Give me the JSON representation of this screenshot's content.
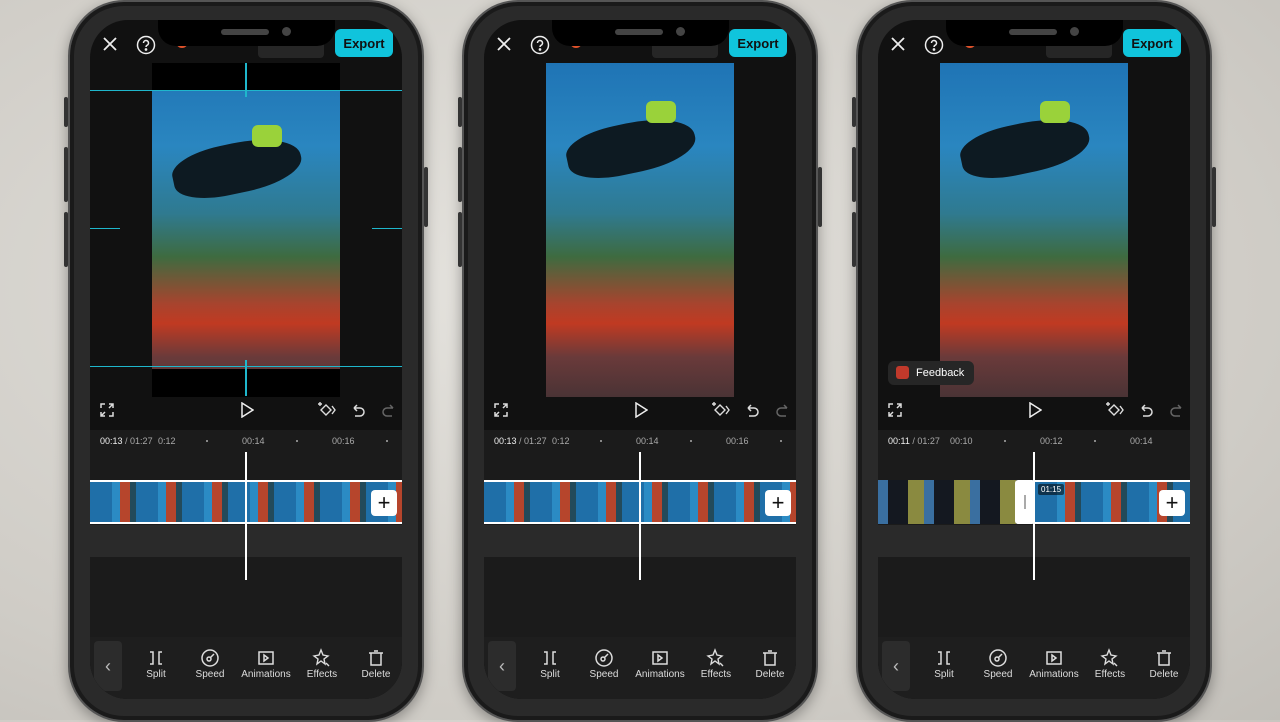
{
  "accent_color": "#10c4dc",
  "phones": [
    {
      "export_label": "Export",
      "current_time": "00:13",
      "total_time": "/ 01:27",
      "ticks": [
        "0:12",
        "00:14",
        "00:16"
      ],
      "crop_mode": true,
      "feedback": null,
      "clip_duration": null,
      "strip_style": "single",
      "tools": [
        "Split",
        "Speed",
        "Animations",
        "Effects",
        "Delete"
      ]
    },
    {
      "export_label": "Export",
      "current_time": "00:13",
      "total_time": "/ 01:27",
      "ticks": [
        "0:12",
        "00:14",
        "00:16"
      ],
      "crop_mode": false,
      "feedback": null,
      "clip_duration": null,
      "strip_style": "single",
      "tools": [
        "Split",
        "Speed",
        "Animations",
        "Effects",
        "Delete"
      ]
    },
    {
      "export_label": "Export",
      "current_time": "00:11",
      "total_time": "/ 01:27",
      "ticks": [
        "00:10",
        "00:12",
        "00:14"
      ],
      "crop_mode": false,
      "feedback": "Feedback",
      "clip_duration": "01:15",
      "strip_style": "two-clips",
      "tools": [
        "Split",
        "Speed",
        "Animations",
        "Effects",
        "Delete"
      ]
    }
  ]
}
